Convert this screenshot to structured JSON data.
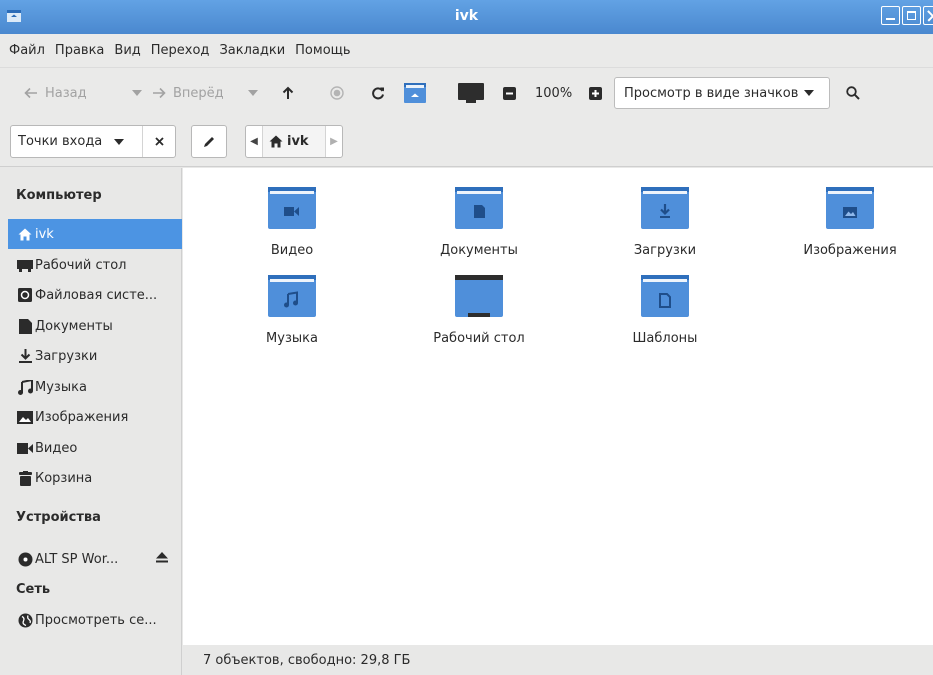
{
  "window": {
    "title": "ivk"
  },
  "menu": [
    "Файл",
    "Правка",
    "Вид",
    "Переход",
    "Закладки",
    "Помощь"
  ],
  "toolbar": {
    "back": "Назад",
    "forward": "Вперёд",
    "zoom": "100%",
    "view_mode": "Просмотр в виде значков"
  },
  "location": {
    "pane": "Точки входа",
    "crumb": "ivk"
  },
  "sidebar": {
    "computer": "Компьютер",
    "devices": "Устройства",
    "network": "Сеть",
    "items": [
      {
        "label": "ivk",
        "icon": "home-icon"
      },
      {
        "label": "Рабочий стол",
        "icon": "desktop-icon"
      },
      {
        "label": "Файловая систе...",
        "icon": "drive-icon"
      },
      {
        "label": "Документы",
        "icon": "document-icon"
      },
      {
        "label": "Загрузки",
        "icon": "download-icon"
      },
      {
        "label": "Музыка",
        "icon": "music-icon"
      },
      {
        "label": "Изображения",
        "icon": "image-icon"
      },
      {
        "label": "Видео",
        "icon": "video-icon"
      },
      {
        "label": "Корзина",
        "icon": "trash-icon"
      }
    ],
    "device_item": "ALT SP Wor...",
    "network_item": "Просмотреть се..."
  },
  "files": [
    {
      "label": "Видео",
      "icon": "folder-video-icon"
    },
    {
      "label": "Документы",
      "icon": "folder-documents-icon"
    },
    {
      "label": "Загрузки",
      "icon": "folder-downloads-icon"
    },
    {
      "label": "Изображения",
      "icon": "folder-pictures-icon"
    },
    {
      "label": "Музыка",
      "icon": "folder-music-icon"
    },
    {
      "label": "Рабочий стол",
      "icon": "folder-desktop-icon"
    },
    {
      "label": "Шаблоны",
      "icon": "folder-templates-icon"
    }
  ],
  "status": "7 объектов, свободно: 29,8 ГБ",
  "colors": {
    "accent": "#4c94e3",
    "titlebar": "#5596dc",
    "folder": "#4f8fda"
  }
}
